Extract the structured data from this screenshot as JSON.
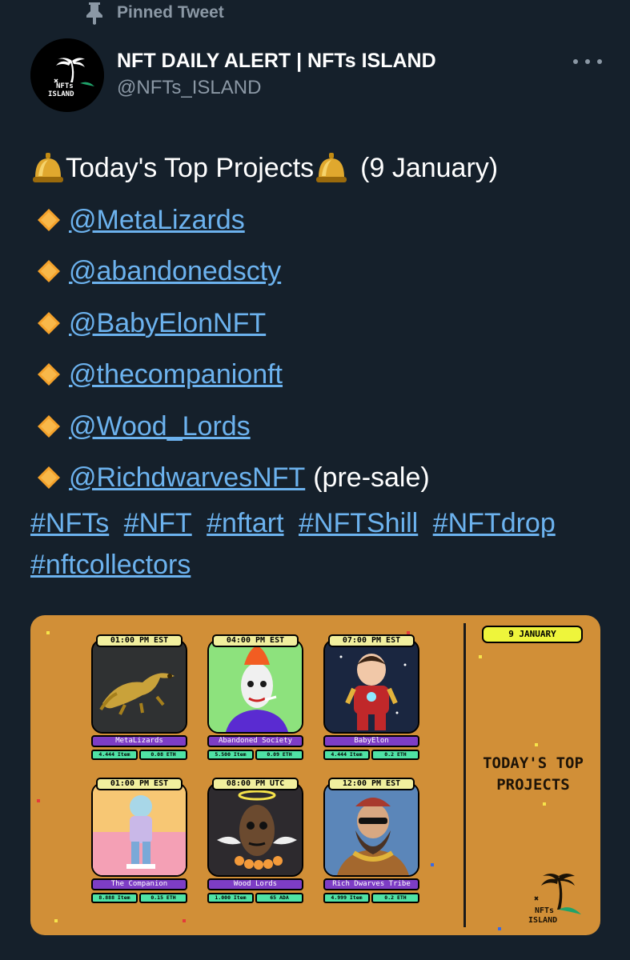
{
  "pinned": {
    "label": "Pinned Tweet",
    "icon": "pin-icon"
  },
  "author": {
    "name": "NFT DAILY ALERT | NFTs ISLAND",
    "handle": "@NFTs_ISLAND",
    "avatar_text_top": "NFTs",
    "avatar_text_bottom": "ISLAND"
  },
  "tweet": {
    "headline": "Today's Top Projects",
    "date_note": "(9 January)",
    "mentions": [
      {
        "handle": "@MetaLizards",
        "note": ""
      },
      {
        "handle": "@abandonedscty",
        "note": ""
      },
      {
        "handle": "@BabyElonNFT",
        "note": ""
      },
      {
        "handle": "@thecompanionft",
        "note": ""
      },
      {
        "handle": "@Wood_Lords",
        "note": ""
      },
      {
        "handle": "@RichdwarvesNFT",
        "note": "(pre-sale)"
      }
    ],
    "hashtags": [
      "#NFTs",
      "#NFT",
      "#nftart",
      "#NFTShill",
      "#NFTdrop",
      "#nftcollectors"
    ]
  },
  "media": {
    "date": "9 JANUARY",
    "title_line1": "TODAY'S TOP",
    "title_line2": "PROJECTS",
    "logo_text_top": "NFTs",
    "logo_text_bottom": "ISLAND",
    "projects": [
      {
        "time": "01:00 PM EST",
        "name": "MetaLizards",
        "items": "4.444 Item",
        "price": "0.08 ETH"
      },
      {
        "time": "04:00 PM EST",
        "name": "Abandoned Society",
        "items": "5.500 Item",
        "price": "0.09 ETH"
      },
      {
        "time": "07:00 PM EST",
        "name": "BabyElon",
        "items": "4.444 Item",
        "price": "0.2 ETH"
      },
      {
        "time": "01:00 PM EST",
        "name": "The Companion",
        "items": "8.888 Item",
        "price": "0.15 ETH"
      },
      {
        "time": "08:00 PM UTC",
        "name": "Wood Lords",
        "items": "1.000 Item",
        "price": "65 ADA"
      },
      {
        "time": "12:00 PM EST",
        "name": "Rich Dwarves Tribe",
        "items": "4.999 Item",
        "price": "0.2 ETH"
      }
    ]
  },
  "colors": {
    "background": "#15202b",
    "link": "#6cb2ee",
    "secondary_text": "#8b98a5",
    "media_background": "#d18f37"
  }
}
